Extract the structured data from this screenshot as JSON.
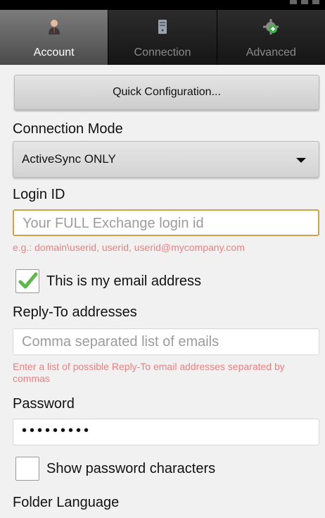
{
  "tabs": [
    {
      "label": "Account",
      "icon": "user-icon",
      "active": true
    },
    {
      "label": "Connection",
      "icon": "server-icon",
      "active": false
    },
    {
      "label": "Advanced",
      "icon": "gear-icon",
      "active": false
    }
  ],
  "quick_config": {
    "label": "Quick Configuration..."
  },
  "connection_mode": {
    "label": "Connection Mode",
    "value": "ActiveSync ONLY"
  },
  "login_id": {
    "label": "Login ID",
    "placeholder": "Your FULL Exchange login id",
    "hint": "e.g.: domain\\userid, userid, userid@mycompany.com"
  },
  "email_checkbox": {
    "label": "This is my email address",
    "checked": true
  },
  "reply_to": {
    "label": "Reply-To addresses",
    "placeholder": "Comma separated list of emails",
    "hint": "Enter a list of possible Reply-To email addresses separated by commas"
  },
  "password": {
    "label": "Password",
    "value": "•••••••••"
  },
  "show_password": {
    "label": "Show password characters",
    "checked": false
  },
  "folder_language": {
    "label": "Folder Language"
  },
  "colors": {
    "hint": "#f08080",
    "focus_border": "#d0a24a",
    "check": "#5fb84a"
  }
}
